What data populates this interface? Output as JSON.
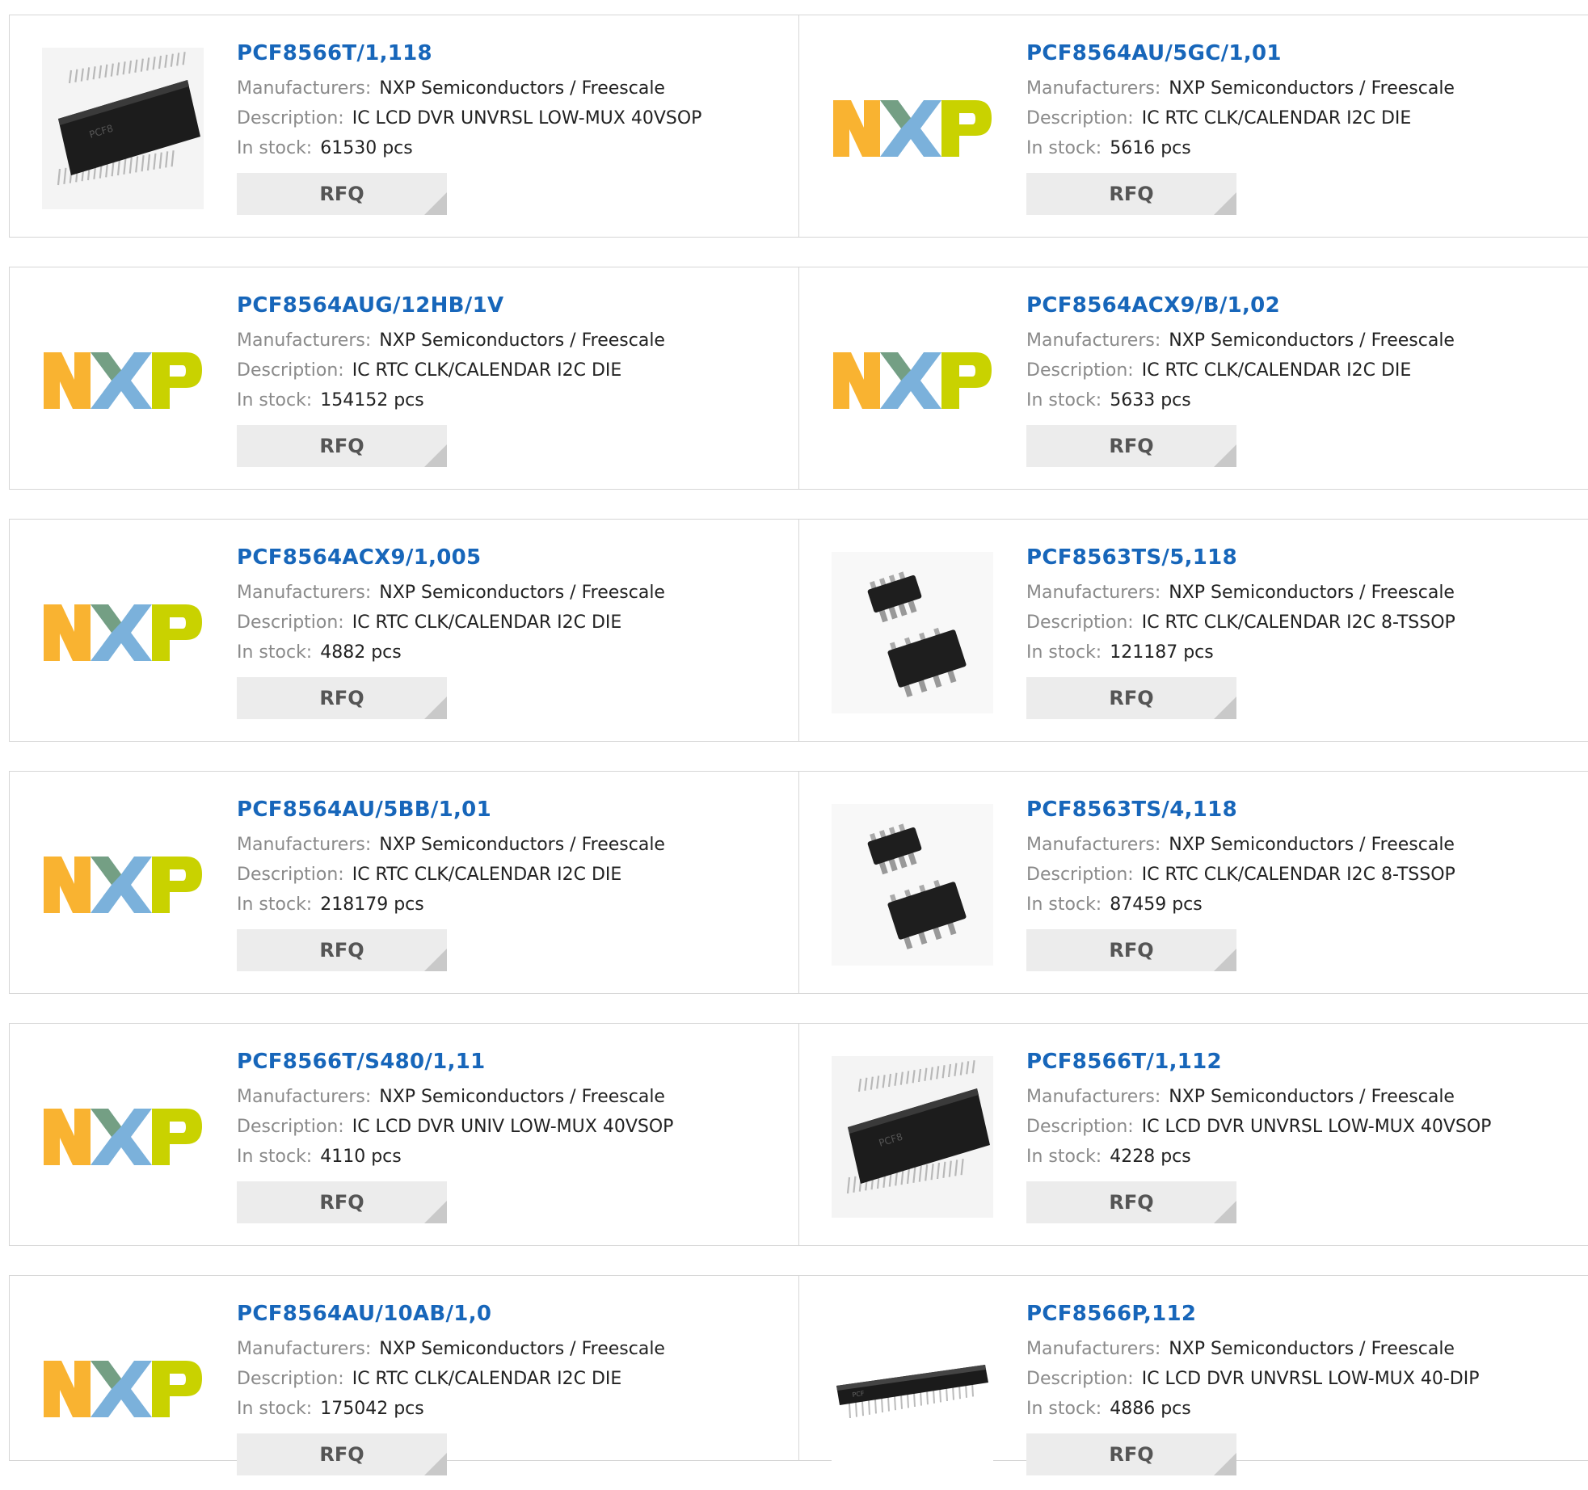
{
  "labels": {
    "manufacturers": "Manufacturers:",
    "description": "Description:",
    "in_stock": "In stock:",
    "rfq": "RFQ"
  },
  "products": [
    {
      "part": "PCF8566T/1,118",
      "manufacturer": "NXP Semiconductors / Freescale",
      "description": "IC LCD DVR UNVRSL LOW-MUX 40VSOP",
      "stock": "61530 pcs",
      "image": "vsop-chip"
    },
    {
      "part": "PCF8564AU/5GC/1,01",
      "manufacturer": "NXP Semiconductors / Freescale",
      "description": "IC RTC CLK/CALENDAR I2C DIE",
      "stock": "5616 pcs",
      "image": "nxp-logo"
    },
    {
      "part": "PCF8564AUG/12HB/1V",
      "manufacturer": "NXP Semiconductors / Freescale",
      "description": "IC RTC CLK/CALENDAR I2C DIE",
      "stock": "154152 pcs",
      "image": "nxp-logo"
    },
    {
      "part": "PCF8564ACX9/B/1,02",
      "manufacturer": "NXP Semiconductors / Freescale",
      "description": "IC RTC CLK/CALENDAR I2C DIE",
      "stock": "5633 pcs",
      "image": "nxp-logo"
    },
    {
      "part": "PCF8564ACX9/1,005",
      "manufacturer": "NXP Semiconductors / Freescale",
      "description": "IC RTC CLK/CALENDAR I2C DIE",
      "stock": "4882 pcs",
      "image": "nxp-logo"
    },
    {
      "part": "PCF8563TS/5,118",
      "manufacturer": "NXP Semiconductors / Freescale",
      "description": "IC RTC CLK/CALENDAR I2C 8-TSSOP",
      "stock": "121187 pcs",
      "image": "tssop-chip"
    },
    {
      "part": "PCF8564AU/5BB/1,01",
      "manufacturer": "NXP Semiconductors / Freescale",
      "description": "IC RTC CLK/CALENDAR I2C DIE",
      "stock": "218179 pcs",
      "image": "nxp-logo"
    },
    {
      "part": "PCF8563TS/4,118",
      "manufacturer": "NXP Semiconductors / Freescale",
      "description": "IC RTC CLK/CALENDAR I2C 8-TSSOP",
      "stock": "87459 pcs",
      "image": "tssop-chip"
    },
    {
      "part": "PCF8566T/S480/1,11",
      "manufacturer": "NXP Semiconductors / Freescale",
      "description": "IC LCD DVR UNIV LOW-MUX 40VSOP",
      "stock": "4110 pcs",
      "image": "nxp-logo"
    },
    {
      "part": "PCF8566T/1,112",
      "manufacturer": "NXP Semiconductors / Freescale",
      "description": "IC LCD DVR UNVRSL LOW-MUX 40VSOP",
      "stock": "4228 pcs",
      "image": "vsop-chip"
    },
    {
      "part": "PCF8564AU/10AB/1,0",
      "manufacturer": "NXP Semiconductors / Freescale",
      "description": "IC RTC CLK/CALENDAR I2C DIE",
      "stock": "175042 pcs",
      "image": "nxp-logo"
    },
    {
      "part": "PCF8566P,112",
      "manufacturer": "NXP Semiconductors / Freescale",
      "description": "IC LCD DVR UNVRSL LOW-MUX 40-DIP",
      "stock": "4886 pcs",
      "image": "dip-chip"
    }
  ],
  "colors": {
    "link": "#1766ba",
    "nxp_orange": "#f9b331",
    "nxp_blue": "#7bb1db",
    "nxp_green": "#c9d200"
  }
}
